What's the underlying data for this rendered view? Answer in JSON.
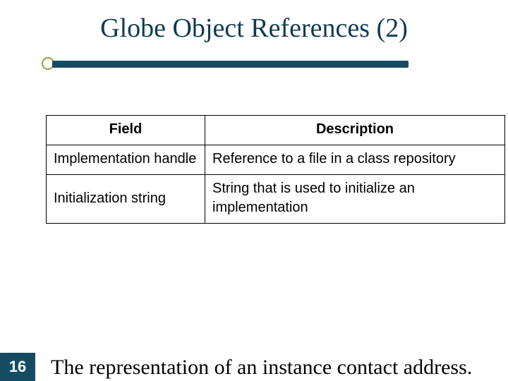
{
  "title": "Globe Object References (2)",
  "page_number": "16",
  "caption": "The representation of an instance contact address.",
  "table": {
    "headers": {
      "field": "Field",
      "description": "Description"
    },
    "rows": [
      {
        "field": "Implementation handle",
        "description": "Reference to a file in a class repository"
      },
      {
        "field": "Initialization string",
        "description": "String that is used to initialize an implementation"
      }
    ]
  }
}
